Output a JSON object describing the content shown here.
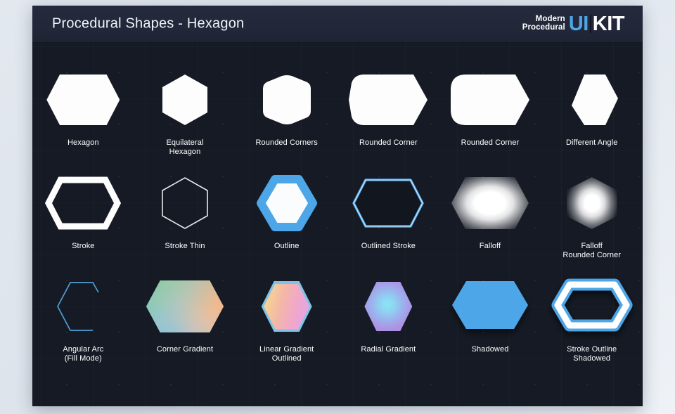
{
  "header": {
    "title": "Procedural Shapes - Hexagon",
    "logo": {
      "line1": "Modern",
      "line2": "Procedural",
      "ui": "UI",
      "kit": "KIT"
    }
  },
  "colors": {
    "page_background": "#e3e8ef",
    "card_background": "#151a24",
    "header_background": "#242a3d",
    "accent_blue": "#4da6e8",
    "shape_white": "#fdfdfd",
    "label_text": "#ffffff"
  },
  "rows": [
    {
      "cells": [
        {
          "label": "Hexagon",
          "variant": "solid-wide"
        },
        {
          "label": "Equilateral\nHexagon",
          "variant": "solid-point"
        },
        {
          "label": "Rounded Corners",
          "variant": "solid-rounded"
        },
        {
          "label": "Rounded Corner",
          "variant": "solid-rounded-bottom"
        },
        {
          "label": "Rounded Corner",
          "variant": "solid-rounded-left"
        },
        {
          "label": "Different Angle",
          "variant": "solid-angle"
        }
      ]
    },
    {
      "cells": [
        {
          "label": "Stroke",
          "variant": "stroke"
        },
        {
          "label": "Stroke Thin",
          "variant": "stroke-thin"
        },
        {
          "label": "Outline",
          "variant": "outline"
        },
        {
          "label": "Outlined Stroke",
          "variant": "outlined-stroke"
        },
        {
          "label": "Falloff",
          "variant": "falloff"
        },
        {
          "label": "Falloff\nRounded Corner",
          "variant": "falloff-rounded"
        }
      ]
    },
    {
      "cells": [
        {
          "label": "Angular Arc\n(Fill Mode)",
          "variant": "angular-arc"
        },
        {
          "label": "Corner Gradient",
          "variant": "corner-gradient"
        },
        {
          "label": "Linear Gradient\nOutlined",
          "variant": "linear-gradient-outlined"
        },
        {
          "label": "Radial Gradient",
          "variant": "radial-gradient"
        },
        {
          "label": "Shadowed",
          "variant": "shadowed"
        },
        {
          "label": "Stroke Outline\nShadowed",
          "variant": "stroke-outline-shadowed"
        }
      ]
    }
  ]
}
